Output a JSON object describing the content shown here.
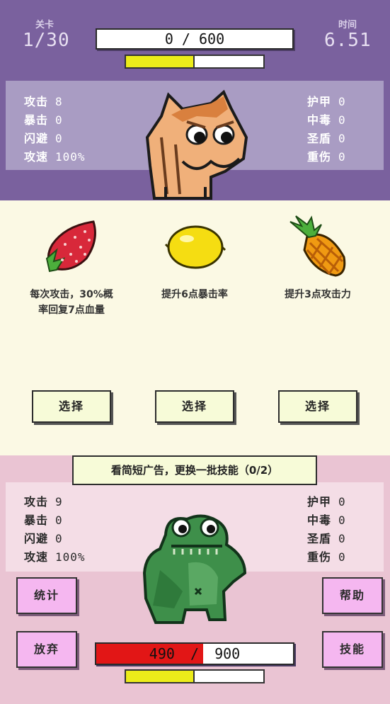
{
  "enemy": {
    "level_label": "关卡",
    "level_value": "1/30",
    "time_label": "时间",
    "time_value": "6.51",
    "hp_text": "0 / 600",
    "hp_fraction": 0.0,
    "energy_fraction": 0.5,
    "stats_left": [
      {
        "label": "攻击",
        "value": "8"
      },
      {
        "label": "暴击",
        "value": "0"
      },
      {
        "label": "闪避",
        "value": "0"
      },
      {
        "label": "攻速",
        "value": "100%"
      }
    ],
    "stats_right": [
      {
        "label": "护甲",
        "value": "0"
      },
      {
        "label": "中毒",
        "value": "0"
      },
      {
        "label": "圣盾",
        "value": "0"
      },
      {
        "label": "重伤",
        "value": "0"
      }
    ]
  },
  "skills": [
    {
      "icon": "strawberry-icon",
      "desc_line1": "每次攻击，30%概",
      "desc_line2": "率回复7点血量",
      "button": "选择"
    },
    {
      "icon": "lemon-icon",
      "desc_line1": "提升6点暴击率",
      "desc_line2": "",
      "button": "选择"
    },
    {
      "icon": "pineapple-icon",
      "desc_line1": "提升3点攻击力",
      "desc_line2": "",
      "button": "选择"
    }
  ],
  "ad_button": "看简短广告，更换一批技能（0/2）",
  "player": {
    "hp_text_left": "490",
    "hp_text_sep": "/",
    "hp_text_right": "900",
    "hp_fraction": 0.544,
    "energy_fraction": 0.5,
    "stats_left": [
      {
        "label": "攻击",
        "value": "9"
      },
      {
        "label": "暴击",
        "value": "0"
      },
      {
        "label": "闪避",
        "value": "0"
      },
      {
        "label": "攻速",
        "value": "100%"
      }
    ],
    "stats_right": [
      {
        "label": "护甲",
        "value": "0"
      },
      {
        "label": "中毒",
        "value": "0"
      },
      {
        "label": "圣盾",
        "value": "0"
      },
      {
        "label": "重伤",
        "value": "0"
      }
    ]
  },
  "buttons": {
    "stats": "统计",
    "give_up": "放弃",
    "help": "帮助",
    "skills": "技能"
  },
  "colors": {
    "enemy_bg": "#7a619e",
    "player_bg": "#eac4d3",
    "hp_red": "#e21616",
    "energy_yellow": "#ecec1a",
    "button_pink": "#f5b7f0"
  }
}
